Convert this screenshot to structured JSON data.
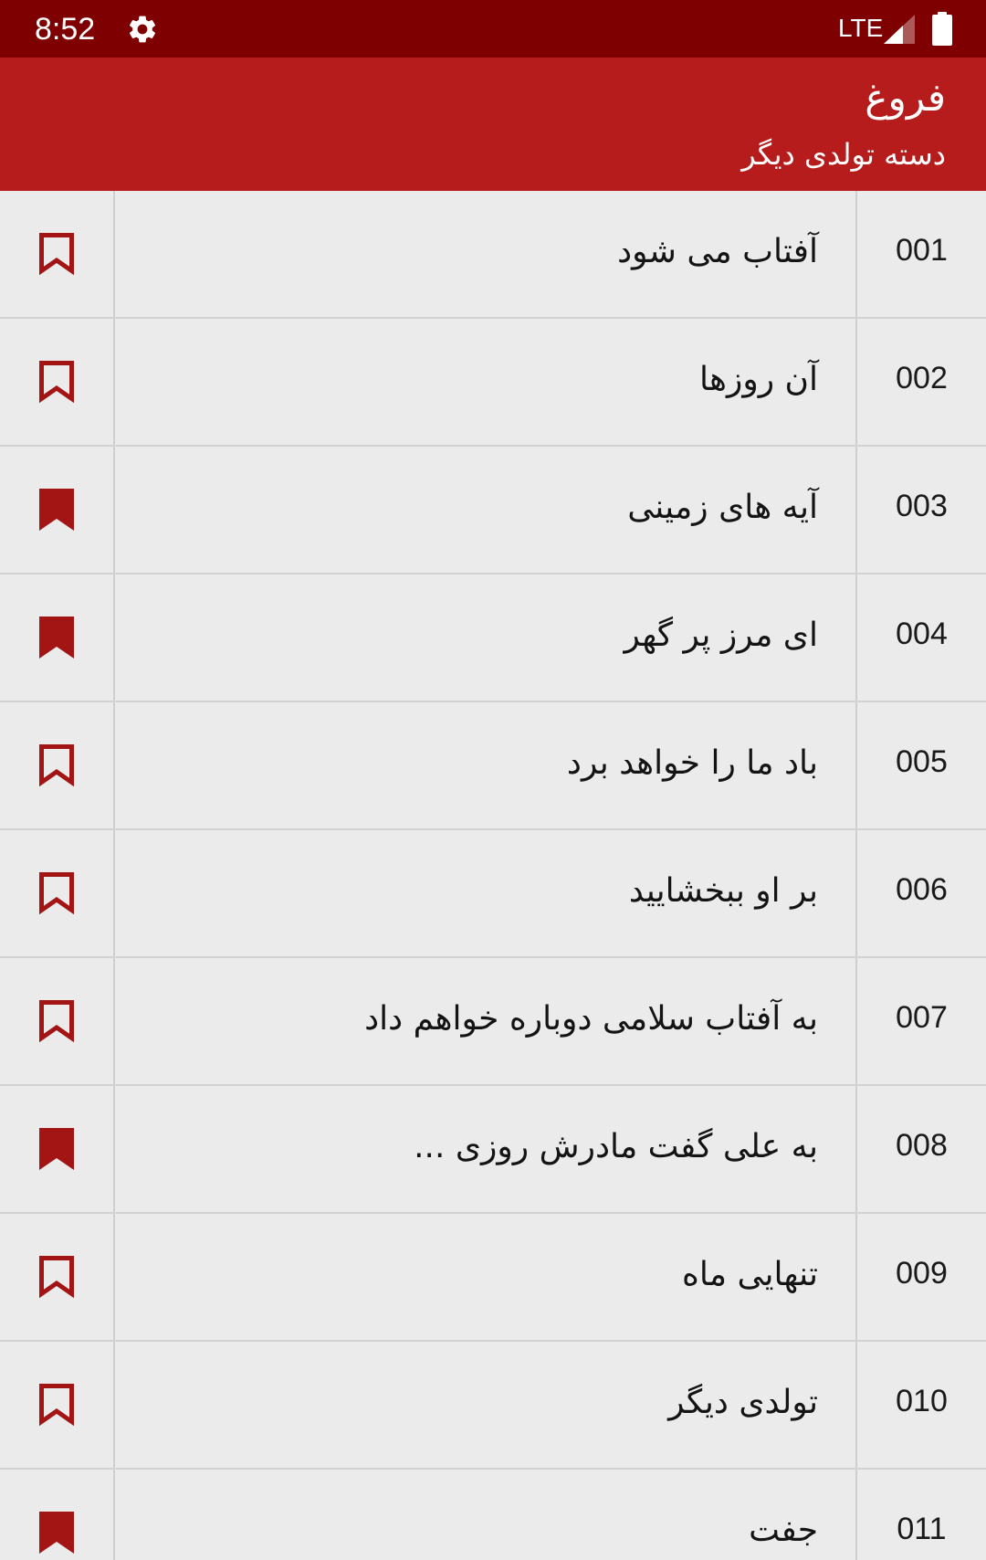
{
  "status_bar": {
    "time": "8:52",
    "network": "LTE",
    "settings_icon": "gear-icon",
    "signal_icon": "cell-signal-icon",
    "battery_icon": "battery-full-icon"
  },
  "app_bar": {
    "title": "فروغ",
    "subtitle": "دسته تولدی دیگر"
  },
  "colors": {
    "status_bar_bg": "#7f0000",
    "app_bar_bg": "#b71c1c",
    "bookmark": "#a31515",
    "row_bg": "#ebebeb",
    "divider": "#cfcfcf"
  },
  "poems": [
    {
      "number": "001",
      "title": "آفتاب می شود",
      "bookmarked": false
    },
    {
      "number": "002",
      "title": "آن روزها",
      "bookmarked": false
    },
    {
      "number": "003",
      "title": "آیه های زمینی",
      "bookmarked": true
    },
    {
      "number": "004",
      "title": "ای مرز پر گهر",
      "bookmarked": true
    },
    {
      "number": "005",
      "title": "باد ما را خواهد برد",
      "bookmarked": false
    },
    {
      "number": "006",
      "title": "بر او ببخشایید",
      "bookmarked": false
    },
    {
      "number": "007",
      "title": "به آفتاب سلامی دوباره خواهم داد",
      "bookmarked": false
    },
    {
      "number": "008",
      "title": "به علی گفت مادرش روزی ...",
      "bookmarked": true
    },
    {
      "number": "009",
      "title": "تنهایی ماه",
      "bookmarked": false
    },
    {
      "number": "010",
      "title": "تولدی دیگر",
      "bookmarked": false
    },
    {
      "number": "011",
      "title": "جفت",
      "bookmarked": true
    }
  ]
}
